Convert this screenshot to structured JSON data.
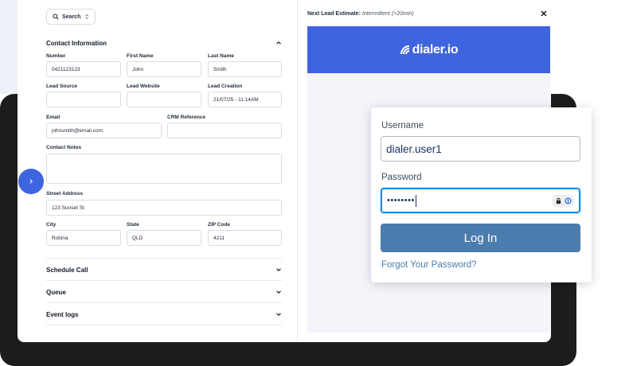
{
  "form": {
    "search_label": "Search",
    "contact_section": "Contact Information",
    "fields": {
      "number": {
        "label": "Number",
        "value": "0421123123"
      },
      "first_name": {
        "label": "First Name",
        "value": "John"
      },
      "last_name": {
        "label": "Last Name",
        "value": "Smith"
      },
      "lead_source": {
        "label": "Lead Source",
        "value": ""
      },
      "lead_website": {
        "label": "Lead Website",
        "value": ""
      },
      "lead_creation": {
        "label": "Lead Creation",
        "value": "21/07/25 - 11:14AM"
      },
      "email": {
        "label": "Email",
        "value": "johnsmith@email.com"
      },
      "crm_reference": {
        "label": "CRM Reference",
        "value": ""
      },
      "contact_notes": {
        "label": "Contact Notes",
        "value": ""
      },
      "street_address": {
        "label": "Street Address",
        "value": "123 Sunset St"
      },
      "city": {
        "label": "City",
        "value": "Robina"
      },
      "state": {
        "label": "State",
        "value": "QLD"
      },
      "zip": {
        "label": "ZIP Code",
        "value": "4211"
      }
    },
    "sections": {
      "schedule_call": "Schedule Call",
      "queue": "Queue",
      "event_logs": "Event logs"
    }
  },
  "lead_estimate": {
    "label": "Next Lead Estimate:",
    "value": "Intermittent (>20min)"
  },
  "preview": {
    "logo_text": "dialer.io",
    "brand_color": "#3f64df"
  },
  "login": {
    "username_label": "Username",
    "username_value": "dialer.user1",
    "password_label": "Password",
    "password_masked": "••••••••",
    "login_button": "Log In",
    "forgot_link": "Forgot Your Password?",
    "button_color": "#4b7cae"
  }
}
